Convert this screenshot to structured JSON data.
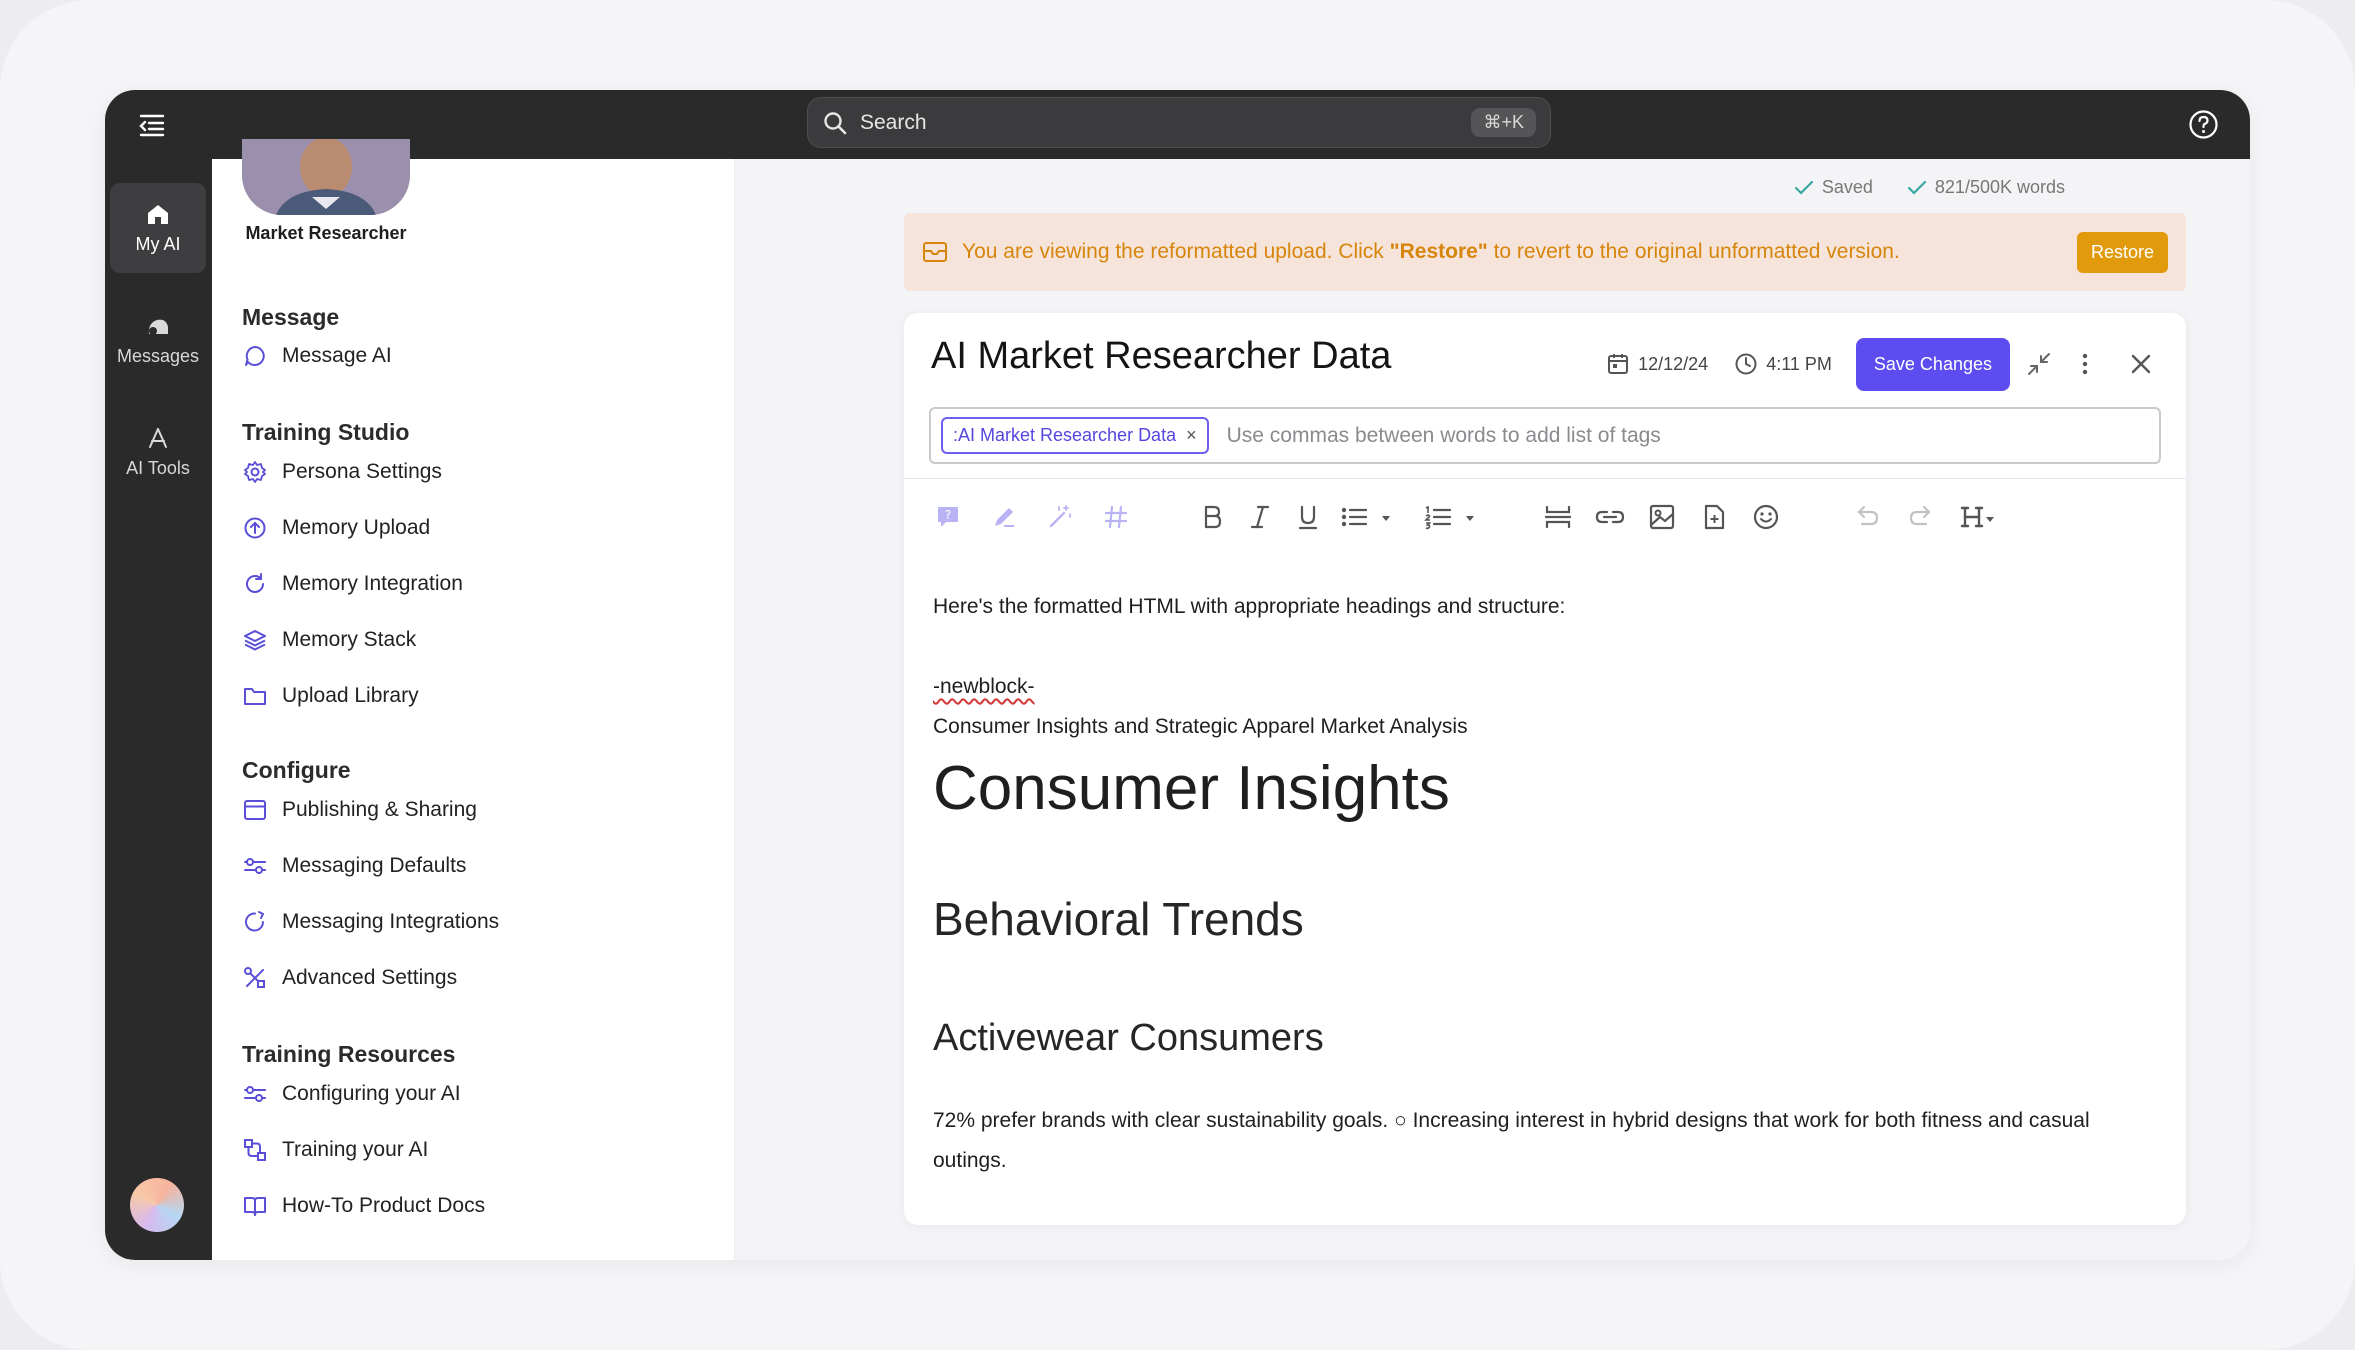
{
  "topbar": {
    "search_placeholder": "Search",
    "search_shortcut": "⌘+K"
  },
  "rail": {
    "items": [
      {
        "label": "My AI",
        "icon": "home-icon",
        "active": true
      },
      {
        "label": "Messages",
        "icon": "messages-icon",
        "active": false
      },
      {
        "label": "AI Tools",
        "icon": "ai-tools-icon",
        "active": false
      }
    ]
  },
  "sidebar": {
    "persona_name": "Market Researcher",
    "sections": {
      "message": {
        "heading": "Message",
        "items": [
          {
            "label": "Message AI",
            "icon": "chat-bubble-icon"
          }
        ]
      },
      "training_studio": {
        "heading": "Training Studio",
        "items": [
          {
            "label": "Persona Settings",
            "icon": "gear-icon"
          },
          {
            "label": "Memory Upload",
            "icon": "upload-icon"
          },
          {
            "label": "Memory Integration",
            "icon": "refresh-icon"
          },
          {
            "label": "Memory Stack",
            "icon": "layers-icon"
          },
          {
            "label": "Upload Library",
            "icon": "folder-icon"
          }
        ]
      },
      "configure": {
        "heading": "Configure",
        "items": [
          {
            "label": "Publishing & Sharing",
            "icon": "window-icon"
          },
          {
            "label": "Messaging Defaults",
            "icon": "sliders-icon"
          },
          {
            "label": "Messaging Integrations",
            "icon": "chat-sync-icon"
          },
          {
            "label": "Advanced Settings",
            "icon": "tools-icon"
          }
        ]
      },
      "training_resources": {
        "heading": "Training Resources",
        "items": [
          {
            "label": "Configuring your AI",
            "icon": "sliders-icon"
          },
          {
            "label": "Training your AI",
            "icon": "flow-icon"
          },
          {
            "label": "How-To Product Docs",
            "icon": "book-icon"
          }
        ]
      }
    }
  },
  "main": {
    "status": {
      "saved": "Saved",
      "words": "821/500K words"
    },
    "banner": {
      "text_before": "You are viewing the reformatted upload. Click ",
      "text_bold": "\"Restore\"",
      "text_after": " to revert to the original unformatted version.",
      "button": "Restore"
    },
    "editor": {
      "title": "AI Market Researcher Data",
      "date": "12/12/24",
      "time": "4:11 PM",
      "save_button": "Save Changes",
      "tag": ":AI Market Researcher Data",
      "tags_placeholder": "Use commas between words to add list of tags",
      "content": {
        "intro": "Here's the formatted HTML with appropriate headings and structure:",
        "newblock": "-newblock-",
        "subtitle": "Consumer Insights and Strategic Apparel Market Analysis",
        "h1": "Consumer Insights",
        "h2": "Behavioral Trends",
        "h3": "Activewear Consumers",
        "body": "72% prefer brands with clear sustainability goals. ○ Increasing interest in hybrid designs that work for both fitness and casual outings."
      }
    }
  },
  "colors": {
    "topbar": "#2a2a2b",
    "accent": "#5d4df0",
    "banner_bg": "#f6e3da",
    "banner_text": "#d7860c",
    "restore_button": "#e19a0b",
    "sidebar_icon": "#5a4fd6"
  }
}
